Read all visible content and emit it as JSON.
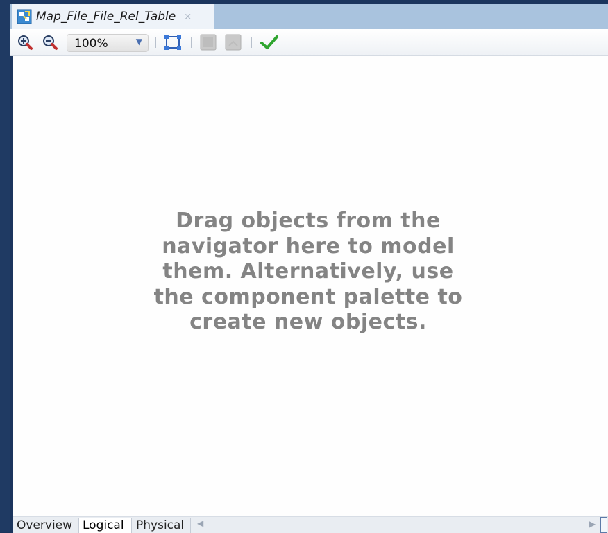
{
  "tab": {
    "title": "Map_File_File_Rel_Table",
    "close": "×",
    "icon": "mapping-diagram-icon"
  },
  "toolbar": {
    "zoom_in_icon": "zoom-in-icon",
    "zoom_out_icon": "zoom-out-icon",
    "zoom_value": "100%",
    "fit_icon": "fit-to-window-icon",
    "validate_icon": "checkmark-icon"
  },
  "canvas": {
    "hint": "Drag objects from the navigator here to model them. Alternatively, use the component palette to create new objects."
  },
  "bottom_tabs": [
    {
      "label": "Overview"
    },
    {
      "label": "Logical"
    },
    {
      "label": "Physical"
    }
  ],
  "colors": {
    "accent": "#a9c3de",
    "check": "#2fa52f",
    "frame": "#1b355d"
  }
}
